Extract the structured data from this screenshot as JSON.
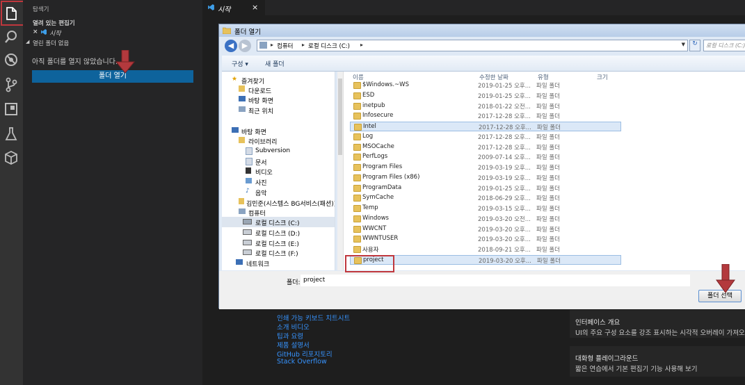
{
  "activity_bar": {
    "icons": [
      "files-icon",
      "search-icon",
      "debug-icon",
      "source-control-icon",
      "extensions-icon",
      "test-icon",
      "package-icon"
    ]
  },
  "sidebar": {
    "header": "탐색기",
    "open_editors_label": "열려 있는 편집기",
    "open_editor_item": "시작",
    "no_folder_section": "열린 폴더 없음",
    "no_folder_message": "아직 폴더를 열지 않았습니다.",
    "open_folder_button": "폴더 열기"
  },
  "editor": {
    "tab_label": "시작",
    "links": [
      "인쇄 가능 키보드 치트시트",
      "소개 비디오",
      "팁과 요령",
      "제품 설명서",
      "GitHub 리포지토리",
      "Stack Overflow"
    ],
    "cards": [
      {
        "title": "인터페이스 개요",
        "desc": "UI의 주요 구성 요소를 강조 표시하는 시각적 오버레이 가져오"
      },
      {
        "title": "대화형 플레이그라운드",
        "desc": "짧은 연습에서 기본 편집기 기능 사용해 보기"
      }
    ]
  },
  "dialog": {
    "title": "폴더 열기",
    "breadcrumb": [
      "컴퓨터",
      "로컬 디스크 (C:)"
    ],
    "search_placeholder": "로컬 디스크 (C:) 검색",
    "toolbar": {
      "organize": "구성 ▾",
      "new_folder": "새 폴더"
    },
    "columns": {
      "name": "이름",
      "date": "수정한 날짜",
      "type": "유형",
      "size": "크기"
    },
    "nav": {
      "favorites": "즐겨찾기",
      "downloads": "다운로드",
      "desktop_fav": "바탕 화면",
      "recent": "최근 위치",
      "desktop": "바탕 화면",
      "libraries": "라이브러리",
      "subversion": "Subversion",
      "documents": "문서",
      "videos": "비디오",
      "pictures": "사진",
      "music": "음악",
      "user": "김민준(시스템스 BG서비스(패션))",
      "computer": "컴퓨터",
      "disk_c": "로컬 디스크 (C:)",
      "disk_d": "로컬 디스크 (D:)",
      "disk_e": "로컬 디스크 (E:)",
      "disk_f": "로컬 디스크 (F:)",
      "network": "네트워크"
    },
    "files": [
      {
        "name": "$Windows.~WS",
        "date": "2019-01-25 오후...",
        "type": "파일 폴더"
      },
      {
        "name": "ESD",
        "date": "2019-01-25 오후...",
        "type": "파일 폴더"
      },
      {
        "name": "inetpub",
        "date": "2018-01-22 오전...",
        "type": "파일 폴더"
      },
      {
        "name": "Infosecure",
        "date": "2017-12-28 오후...",
        "type": "파일 폴더"
      },
      {
        "name": "Intel",
        "date": "2017-12-28 오후...",
        "type": "파일 폴더"
      },
      {
        "name": "Log",
        "date": "2017-12-28 오후...",
        "type": "파일 폴더"
      },
      {
        "name": "MSOCache",
        "date": "2017-12-28 오후...",
        "type": "파일 폴더"
      },
      {
        "name": "PerfLogs",
        "date": "2009-07-14 오후...",
        "type": "파일 폴더"
      },
      {
        "name": "Program Files",
        "date": "2019-03-19 오후...",
        "type": "파일 폴더"
      },
      {
        "name": "Program Files (x86)",
        "date": "2019-03-19 오후...",
        "type": "파일 폴더"
      },
      {
        "name": "ProgramData",
        "date": "2019-01-25 오후...",
        "type": "파일 폴더"
      },
      {
        "name": "SymCache",
        "date": "2018-06-29 오후...",
        "type": "파일 폴더"
      },
      {
        "name": "Temp",
        "date": "2019-03-15 오후...",
        "type": "파일 폴더"
      },
      {
        "name": "Windows",
        "date": "2019-03-20 오전...",
        "type": "파일 폴더"
      },
      {
        "name": "WWCNT",
        "date": "2019-03-20 오후...",
        "type": "파일 폴더"
      },
      {
        "name": "WWNTUSER",
        "date": "2019-03-20 오후...",
        "type": "파일 폴더"
      },
      {
        "name": "사용자",
        "date": "2018-09-21 오후...",
        "type": "파일 폴더"
      },
      {
        "name": "project",
        "date": "2019-03-20 오후...",
        "type": "파일 폴더"
      }
    ],
    "folder_label": "폴더:",
    "folder_value": "project",
    "select_button": "폴더 선택"
  }
}
